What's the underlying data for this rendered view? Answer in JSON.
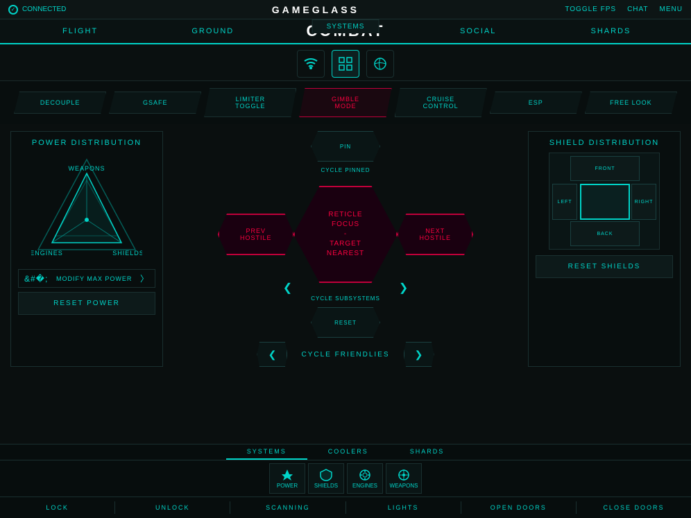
{
  "topBar": {
    "connected": "CONNECTED",
    "title": "GAME",
    "titleBold": "GLASS",
    "toggleFps": "TOGGLE FPS",
    "chat": "CHAT",
    "menu": "MENU"
  },
  "systemsNav": {
    "tab": "SYSTEMS",
    "navItems": [
      {
        "id": "flight",
        "label": "FLIGHT",
        "active": false
      },
      {
        "id": "ground",
        "label": "GROUND",
        "active": false
      },
      {
        "id": "combat",
        "label": "COMBAT",
        "active": true
      },
      {
        "id": "social",
        "label": "SOCIAL",
        "active": false
      },
      {
        "id": "shards",
        "label": "SHARDS",
        "active": false
      }
    ]
  },
  "funcButtons": [
    {
      "id": "decouple",
      "label": "DECOUPLE",
      "active": false
    },
    {
      "id": "gsafe",
      "label": "GSAFE",
      "active": false
    },
    {
      "id": "limiter",
      "label": "LIMITER\nTOGGLE",
      "active": false
    },
    {
      "id": "gimble",
      "label": "GIMBLE\nMODE",
      "active": true
    },
    {
      "id": "cruise",
      "label": "CRUISE\nCONTROL",
      "active": false
    },
    {
      "id": "esp",
      "label": "ESP",
      "active": false
    },
    {
      "id": "freelook",
      "label": "FREE LOOK",
      "active": false
    }
  ],
  "leftPanel": {
    "title": "POWER DISTRIBUTION",
    "labels": {
      "weapons": "WEAPONS",
      "shields": "SHIELDS",
      "engines": "ENGINES"
    },
    "controls": {
      "modifyLabel": "MODIFY MAX POWER"
    },
    "resetBtn": "RESET POWER"
  },
  "centerPanel": {
    "pin": "PIN",
    "cyclePinned": "CYCLE PINNED",
    "reticleFocus": "RETICLE\nFOCUS",
    "dash": "-",
    "targetNearest": "TARGET\nNEAREST",
    "prevHostile": "PREV\nHOSTILE",
    "nextHostile": "NEXT\nHOSTILE",
    "cycleSubsystems": "CYCLE SUBSYSTEMS",
    "reset": "RESET",
    "cycleFriendlies": "CYCLE FRIENDLIES"
  },
  "rightPanel": {
    "title": "SHIELD DISTRIBUTION",
    "labels": {
      "front": "FRONT",
      "back": "BACK",
      "left": "LEFT",
      "right": "RIGHT"
    },
    "resetBtn": "RESET SHIELDS"
  },
  "bottomTabs": [
    {
      "id": "systems",
      "label": "SYSTEMS",
      "active": true
    },
    {
      "id": "coolers",
      "label": "COOLERS",
      "active": false
    },
    {
      "id": "shards",
      "label": "SHARDS",
      "active": false
    }
  ],
  "bottomIcons": [
    {
      "id": "power",
      "label": "POWER",
      "icon": "⚡"
    },
    {
      "id": "shields",
      "label": "SHIELDS",
      "icon": "🛡"
    },
    {
      "id": "engines",
      "label": "ENGINES",
      "icon": "⚙"
    },
    {
      "id": "weapons",
      "label": "WEAPONS",
      "icon": "⊕"
    }
  ],
  "bottomActions": [
    {
      "id": "lock",
      "label": "LOCK"
    },
    {
      "id": "unlock",
      "label": "UNLOCK"
    },
    {
      "id": "scanning",
      "label": "SCANNING"
    },
    {
      "id": "lights",
      "label": "LIGHTS"
    },
    {
      "id": "open-doors",
      "label": "OPEN DOORS"
    },
    {
      "id": "close-doors",
      "label": "CLOSE DOORS"
    }
  ]
}
